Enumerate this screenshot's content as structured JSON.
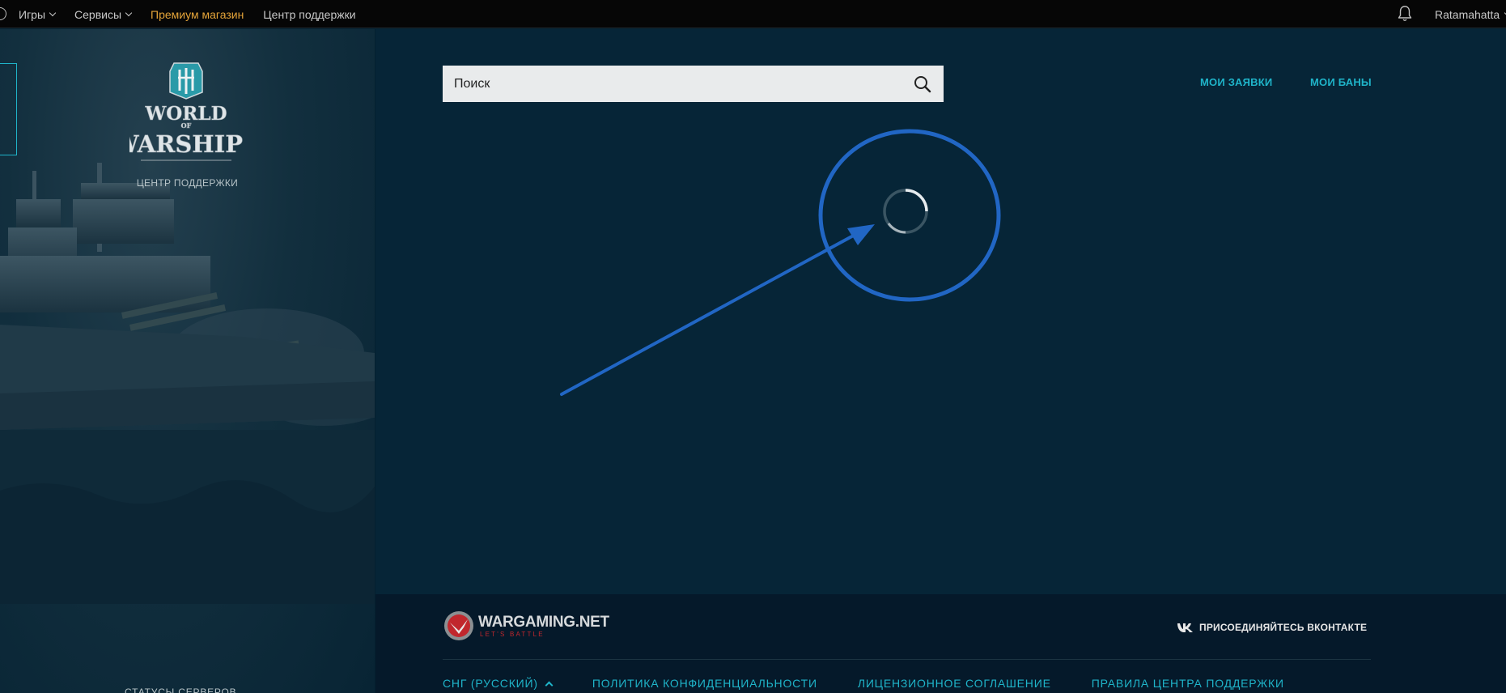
{
  "topbar": {
    "nav": [
      {
        "label": "Игры",
        "has_dropdown": true
      },
      {
        "label": "Сервисы",
        "has_dropdown": true
      },
      {
        "label": "Премиум магазин",
        "has_dropdown": false
      },
      {
        "label": "Центр поддержки",
        "has_dropdown": false
      }
    ],
    "username": "Ratamahatta",
    "icons": {
      "notifications": "bell-icon",
      "wg": "wargaming-icon"
    }
  },
  "sidebar": {
    "logo_lines": [
      "WORLD",
      "OF",
      "WARSHIPS"
    ],
    "subtitle": "ЦЕНТР ПОДДЕРЖКИ",
    "statuses_label": "СТАТУСЫ СЕРВЕРОВ"
  },
  "main": {
    "search_placeholder": "Поиск",
    "my_requests": "МОИ ЗАЯВКИ",
    "my_bans": "МОИ БАНЫ",
    "state": "loading"
  },
  "footer": {
    "brand": "WARGAMING.NET",
    "tagline": "LET'S BATTLE",
    "vk_label": "ПРИСОЕДИНЯЙТЕСЬ ВКОНТАКТЕ",
    "links": [
      {
        "label": "СНГ (РУССКИЙ)",
        "has_caret": true
      },
      {
        "label": "ПОЛИТИКА КОНФИДЕНЦИАЛЬНОСТИ"
      },
      {
        "label": "ЛИЦЕНЗИОННОЕ СОГЛАШЕНИЕ"
      },
      {
        "label": "ПРАВИЛА ЦЕНТРА ПОДДЕРЖКИ"
      }
    ]
  },
  "colors": {
    "accent": "#1fb4c9",
    "premium": "#e3a339",
    "annotation": "#2166c4",
    "background": "#062537"
  }
}
